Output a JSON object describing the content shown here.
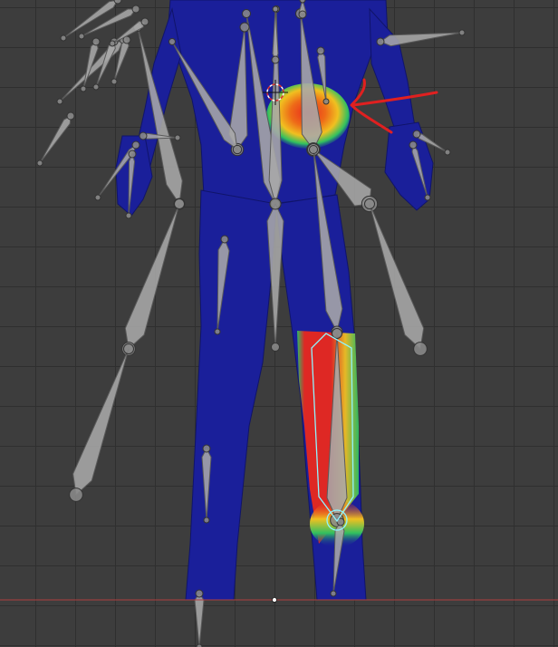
{
  "viewport": {
    "mode": "Weight Paint",
    "grid": true,
    "colors": {
      "background": "#3d3d3d",
      "grid_line": "#2f2f2f",
      "horizon_line": "#b04040",
      "mesh_zero_weight": "#1a1f9a",
      "weight_high": "#e8281e",
      "weight_mid": "#f0c020",
      "weight_low": "#30c060",
      "bone_fill": "#a8a8a8",
      "bone_active_outline": "#8ff5ff",
      "annotation_arrow": "#e02020"
    }
  },
  "armature": {
    "active_bone": "lower-leg-right",
    "bone_count_visible": 34
  },
  "annotation": {
    "shape": "arrow",
    "points_to": "pelvis-weight-area"
  }
}
